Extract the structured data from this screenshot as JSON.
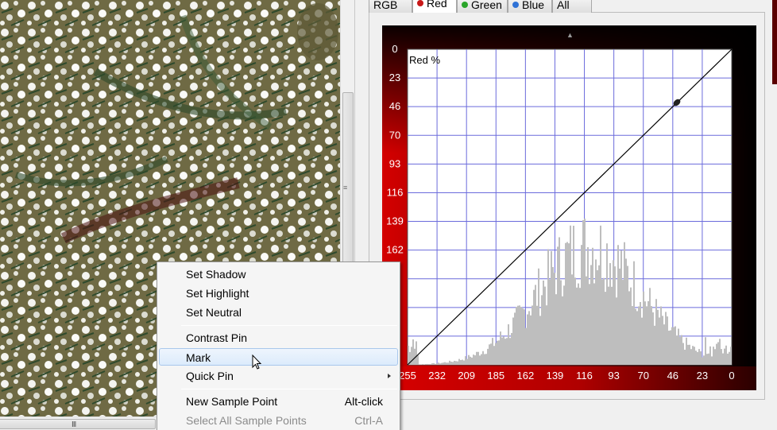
{
  "tabs": [
    {
      "label": "RGB",
      "dot": null
    },
    {
      "label": "Red",
      "dot": "#c81818"
    },
    {
      "label": "Green",
      "dot": "#2aa52a"
    },
    {
      "label": "Blue",
      "dot": "#2f72d6"
    },
    {
      "label": "All",
      "dot": null
    }
  ],
  "active_tab": "Red",
  "curve_panel": {
    "channel_label": "Red %",
    "y_ticks": [
      "0",
      "23",
      "46",
      "70",
      "93",
      "116",
      "139",
      "162"
    ],
    "x_ticks": [
      "255",
      "232",
      "209",
      "185",
      "162",
      "139",
      "116",
      "93",
      "70",
      "46",
      "23",
      "0"
    ],
    "colors": {
      "grid": "#6b6bdc",
      "frame_dark": "#000000",
      "frame_red": "#d40000",
      "histogram": "#bebebe"
    }
  },
  "context_menu": {
    "items": [
      {
        "label": "Set Shadow",
        "shortcut": "",
        "disabled": false,
        "submenu": false
      },
      {
        "label": "Set Highlight",
        "shortcut": "",
        "disabled": false,
        "submenu": false
      },
      {
        "label": "Set Neutral",
        "shortcut": "",
        "disabled": false,
        "submenu": false
      },
      {
        "label": "Contrast Pin",
        "shortcut": "",
        "disabled": false,
        "submenu": false
      },
      {
        "label": "Mark",
        "shortcut": "",
        "disabled": false,
        "submenu": false,
        "hover": true
      },
      {
        "label": "Quick Pin",
        "shortcut": "",
        "disabled": false,
        "submenu": true
      },
      {
        "label": "New Sample Point",
        "shortcut": "Alt-click",
        "disabled": false,
        "submenu": false
      },
      {
        "label": "Select All Sample Points",
        "shortcut": "Ctrl-A",
        "disabled": true,
        "submenu": false
      }
    ]
  }
}
